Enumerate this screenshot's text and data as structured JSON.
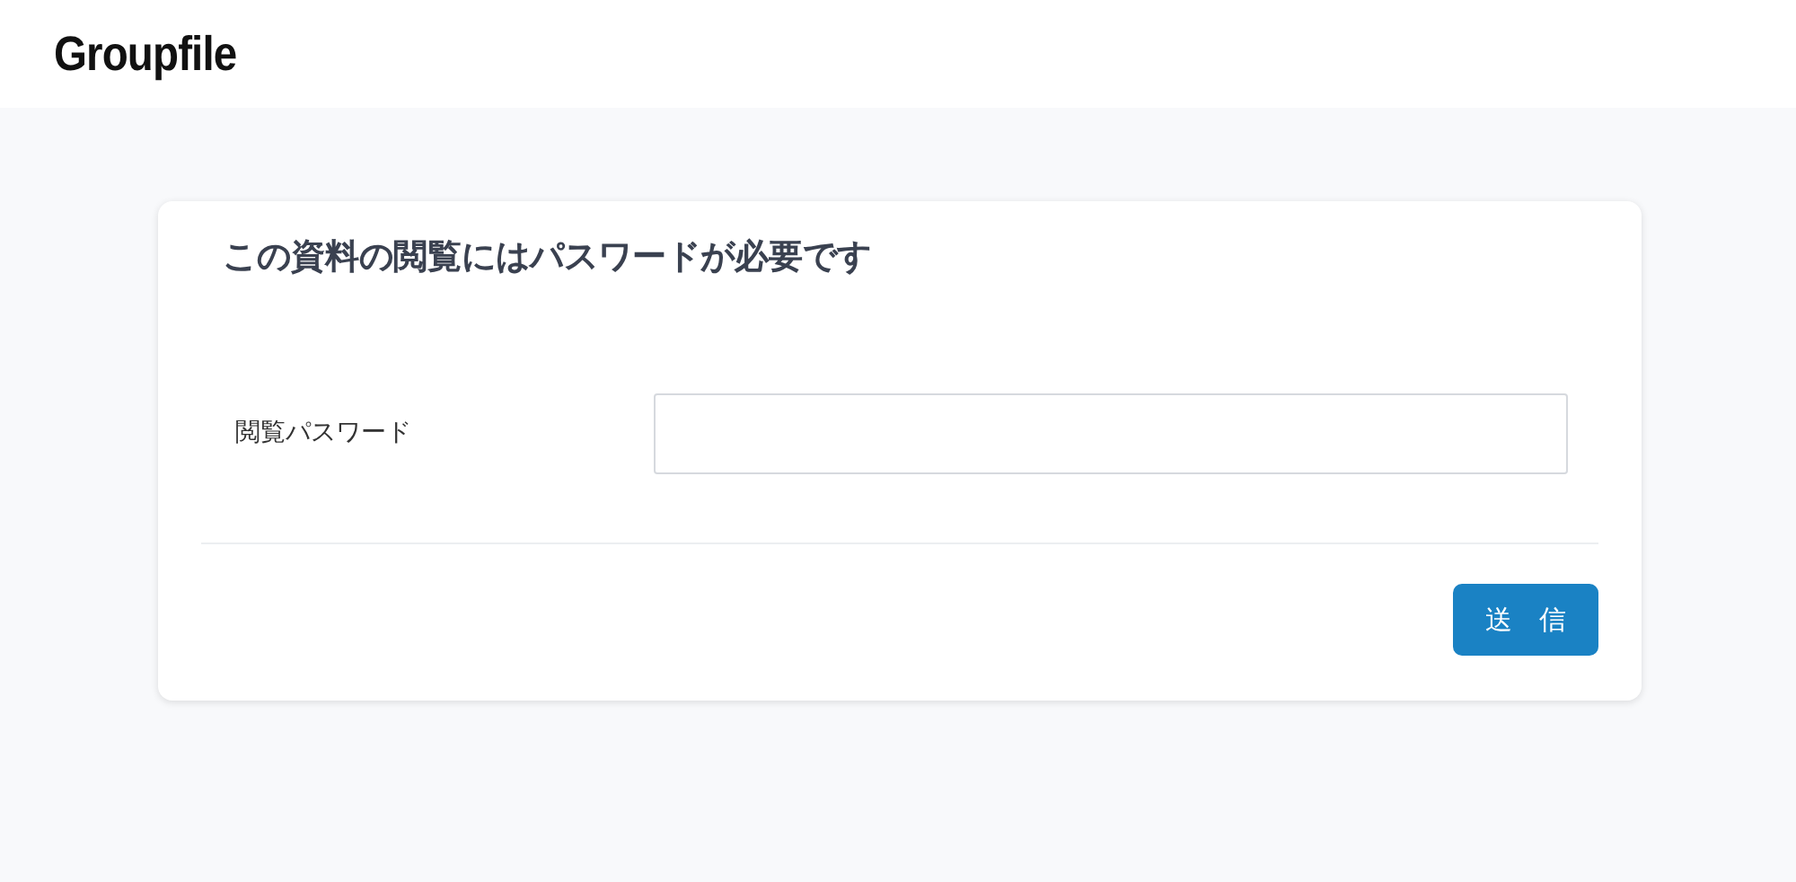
{
  "header": {
    "logo": "Groupfile"
  },
  "card": {
    "title": "この資料の閲覧にはパスワードが必要です",
    "field": {
      "label": "閲覧パスワード"
    },
    "submit_button": "送　信"
  }
}
